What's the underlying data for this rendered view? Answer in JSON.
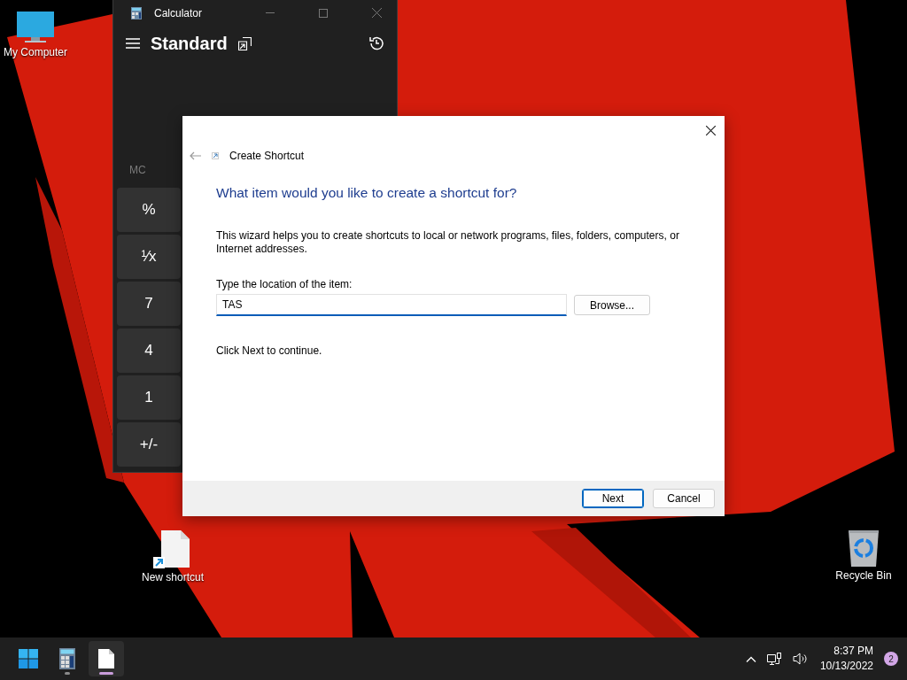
{
  "desktop_icons": [
    {
      "kind": "computer",
      "label": "My Computer"
    },
    {
      "kind": "shortcut",
      "label": "New shortcut"
    },
    {
      "kind": "recycle",
      "label": "Recycle Bin"
    }
  ],
  "calculator": {
    "title": "Calculator",
    "mode": "Standard",
    "memory": [
      "MC"
    ],
    "keys": [
      "%",
      "¹⁄x",
      "7",
      "4",
      "1",
      "+/-"
    ]
  },
  "dialog": {
    "title": "Create Shortcut",
    "heading": "What item would you like to create a shortcut for?",
    "description": "This wizard helps you to create shortcuts to local or network programs, files, folders, computers, or Internet addresses.",
    "field_label": "Type the location of the item:",
    "field_value": "TAS",
    "browse_button": "Browse...",
    "hint": "Click Next to continue.",
    "buttons": [
      {
        "label": "Next",
        "default": true
      },
      {
        "label": "Cancel",
        "default": false
      }
    ]
  },
  "taskbar": {
    "apps": [
      {
        "kind": "calculator",
        "selected": false
      },
      {
        "kind": "document",
        "selected": true
      }
    ],
    "time": "8:37 PM",
    "date": "10/13/2022",
    "notification_count": "2"
  }
}
